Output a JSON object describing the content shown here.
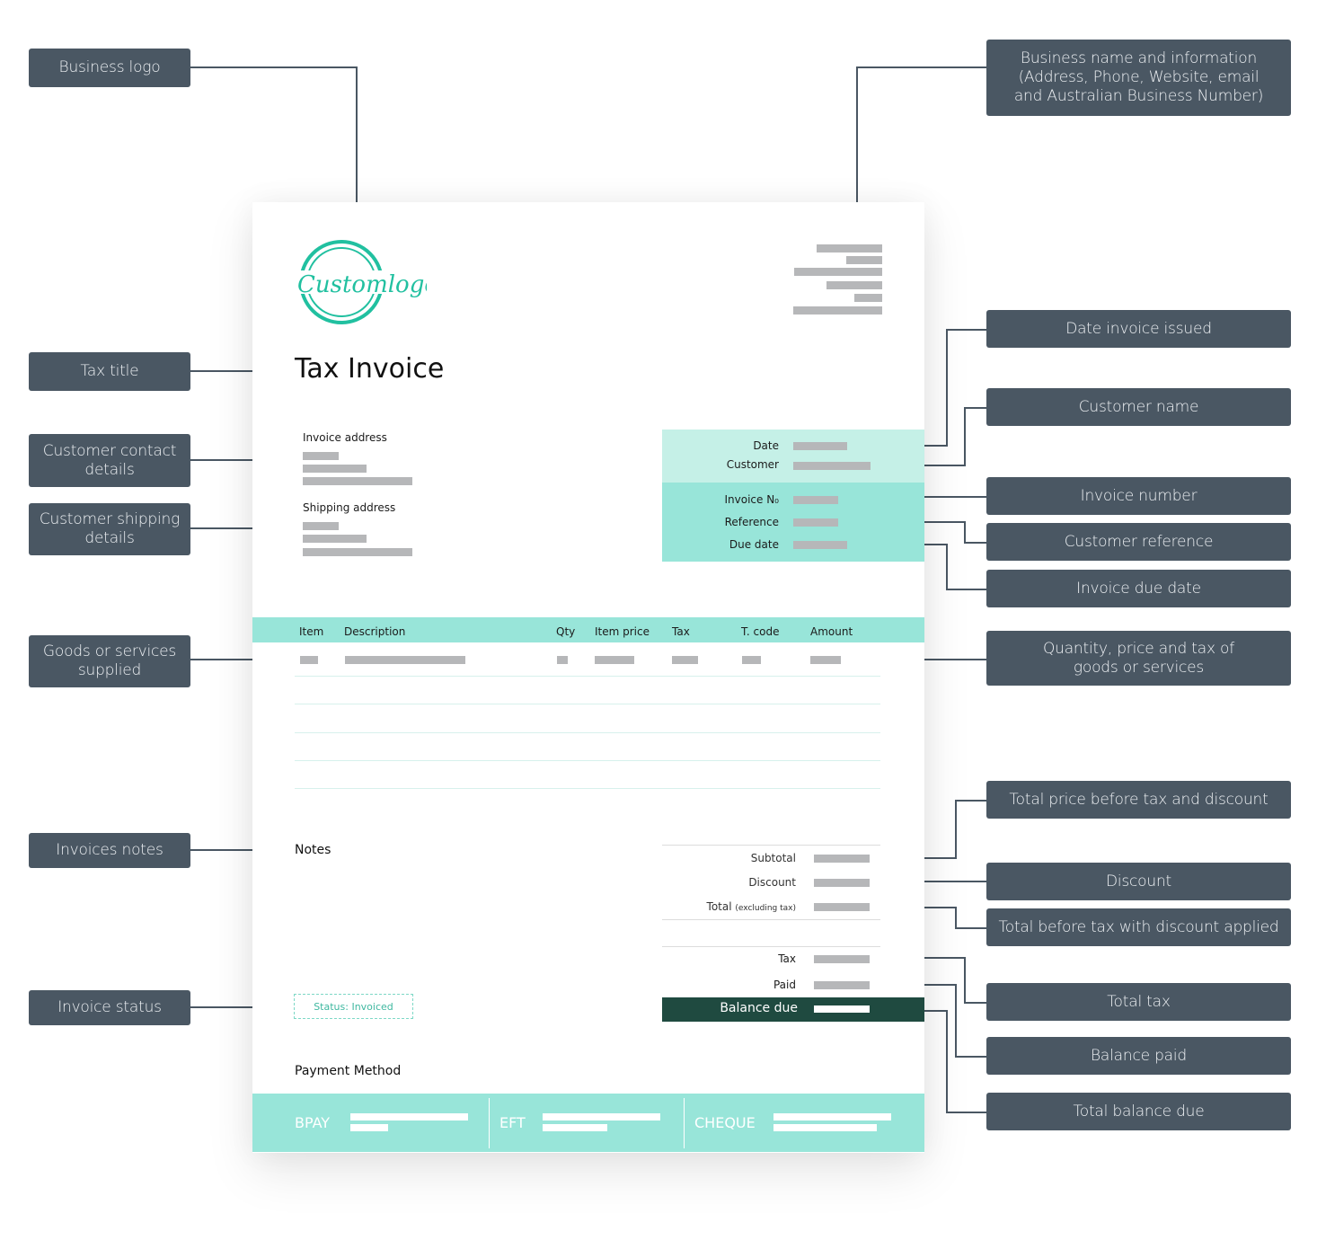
{
  "callouts_left": {
    "business_logo": "Business logo",
    "tax_title": "Tax title",
    "customer_contact": "Customer contact details",
    "customer_shipping": "Customer shipping details",
    "goods_services": "Goods or services supplied",
    "invoice_notes": "Invoices notes",
    "invoice_status": "Invoice status"
  },
  "callouts_right": {
    "business_info": "Business name and information (Address, Phone, Website, email and Australian Business Number)",
    "date_issued": "Date invoice issued",
    "customer_name": "Customer name",
    "invoice_number": "Invoice number",
    "customer_reference": "Customer reference",
    "invoice_due_date": "Invoice due date",
    "qty_price_tax": "Quantity, price and tax of goods or services",
    "total_before_tax_discount": "Total price before tax and discount",
    "discount": "Discount",
    "total_with_discount": "Total before tax with discount applied",
    "total_tax": "Total tax",
    "balance_paid": "Balance paid",
    "total_balance_due": "Total balance due"
  },
  "invoice": {
    "logo_text": "Customlogo",
    "title": "Tax Invoice",
    "invoice_address_label": "Invoice address",
    "shipping_address_label": "Shipping address",
    "meta": {
      "date": "Date",
      "customer": "Customer",
      "invoice_no": "Invoice N₀",
      "reference": "Reference",
      "due_date": "Due date"
    },
    "table_headers": [
      "Item",
      "Description",
      "Qty",
      "Item price",
      "Tax",
      "T. code",
      "Amount"
    ],
    "notes_label": "Notes",
    "totals": {
      "subtotal": "Subtotal",
      "discount": "Discount",
      "total": "Total",
      "total_note": "(excluding tax)",
      "tax": "Tax",
      "paid": "Paid",
      "balance_due": "Balance due"
    },
    "status": "Status: Invoiced",
    "payment_method_label": "Payment Method",
    "payment_methods": [
      "BPAY",
      "EFT",
      "CHEQUE"
    ]
  },
  "colors": {
    "callout_bg": "#4a5763",
    "accent_teal": "#98e5d9",
    "light_teal": "#c5f0e7",
    "dark_green": "#1f4a40",
    "logo_teal": "#21c0a0",
    "placeholder_grey": "#b6b7b9"
  }
}
